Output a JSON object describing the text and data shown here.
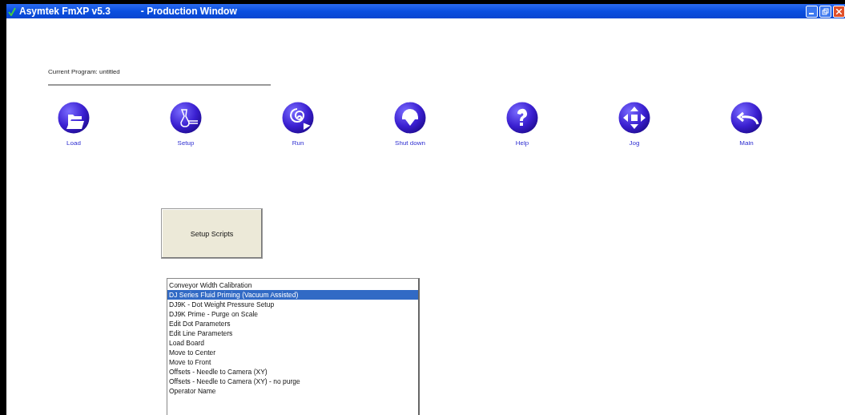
{
  "window": {
    "title": "Asymtek FmXP v5.3",
    "subtitle": "- Production Window"
  },
  "current_program": "Current Program: untitled",
  "toolbar": [
    {
      "label": "Load",
      "kind": "load"
    },
    {
      "label": "Setup",
      "kind": "setup"
    },
    {
      "label": "Run",
      "kind": "run"
    },
    {
      "label": "Shut down",
      "kind": "shutdown"
    },
    {
      "label": "Help",
      "kind": "help"
    },
    {
      "label": "Jog",
      "kind": "jog"
    },
    {
      "label": "Main",
      "kind": "main"
    }
  ],
  "setup_button": "Setup Scripts",
  "scripts": [
    {
      "label": "Conveyor Width Calibration",
      "selected": false
    },
    {
      "label": "DJ Series Fluid Priming (Vacuum Assisted)",
      "selected": true
    },
    {
      "label": "DJ9K - Dot Weight Pressure Setup",
      "selected": false
    },
    {
      "label": "DJ9K Prime - Purge on Scale",
      "selected": false
    },
    {
      "label": "Edit Dot Parameters",
      "selected": false
    },
    {
      "label": "Edit Line Parameters",
      "selected": false
    },
    {
      "label": "Load Board",
      "selected": false
    },
    {
      "label": "Move to Center",
      "selected": false
    },
    {
      "label": "Move to Front",
      "selected": false
    },
    {
      "label": "Offsets - Needle to Camera (XY)",
      "selected": false
    },
    {
      "label": "Offsets - Needle to Camera (XY) - no purge",
      "selected": false
    },
    {
      "label": "Operator Name",
      "selected": false
    }
  ]
}
